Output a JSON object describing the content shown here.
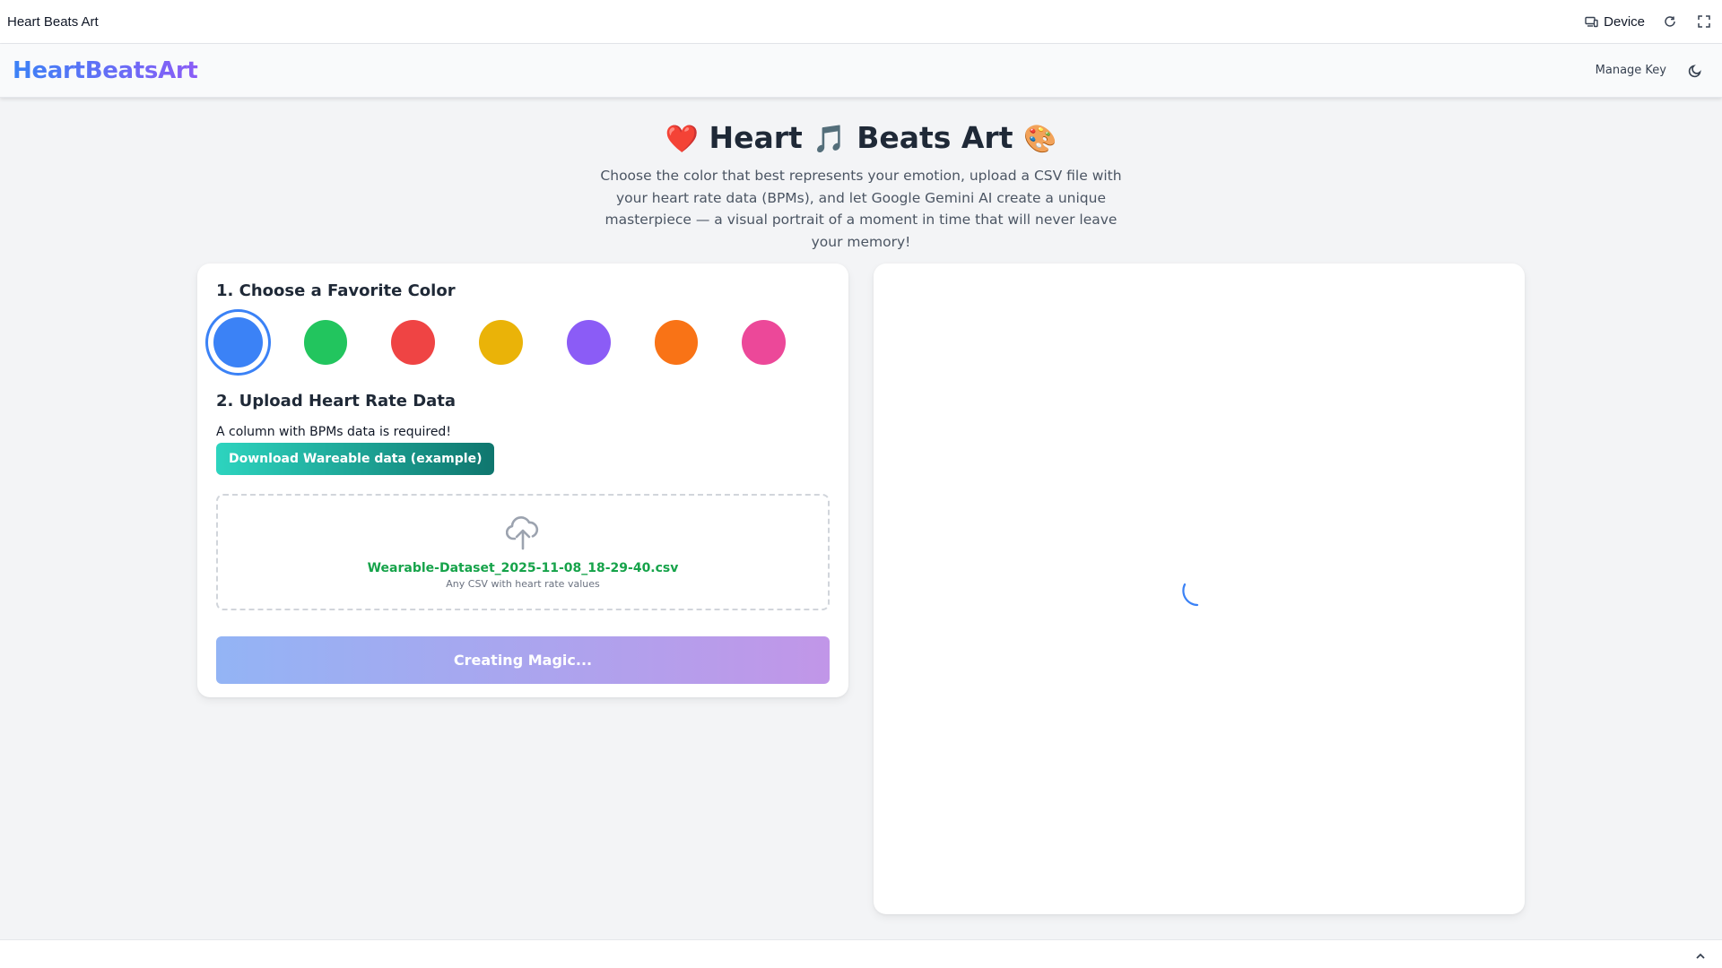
{
  "topbar": {
    "title": "Heart Beats Art",
    "device_label": "Device",
    "icons": [
      "device-icon",
      "refresh-icon",
      "fullscreen-icon"
    ]
  },
  "header": {
    "brand": "HeartBeatsArt",
    "manage_key_label": "Manage Key",
    "theme_icon": "moon-icon"
  },
  "hero": {
    "title_parts": [
      "❤️",
      "Heart",
      "🎵",
      "Beats Art",
      "🎨"
    ],
    "description": "Choose the color that best represents your emotion, upload a CSV file with your heart rate data (BPMs), and let Google Gemini AI create a unique masterpiece — a visual portrait of a moment in time that will never leave your memory!"
  },
  "form": {
    "color_section_title": "1. Choose a Favorite Color",
    "colors": [
      {
        "name": "blue",
        "hex": "#3b82f6",
        "selected": true
      },
      {
        "name": "green",
        "hex": "#22c55e",
        "selected": false
      },
      {
        "name": "red",
        "hex": "#ef4444",
        "selected": false
      },
      {
        "name": "yellow",
        "hex": "#eab308",
        "selected": false
      },
      {
        "name": "purple",
        "hex": "#8b5cf6",
        "selected": false
      },
      {
        "name": "orange",
        "hex": "#f97316",
        "selected": false
      },
      {
        "name": "pink",
        "hex": "#ec4899",
        "selected": false
      }
    ],
    "upload_section_title": "2. Upload Heart Rate Data",
    "upload_note": "A column with BPMs data is required!",
    "download_button_label": "Download Wareable data (example)",
    "upload_icon": "cloud-upload-icon",
    "file_name": "Wearable-Dataset_2025-11-08_18-29-40.csv",
    "file_hint": "Any CSV with heart rate values",
    "create_button_label": "Creating Magic..."
  },
  "preview": {
    "state_icon": "loading-spinner-icon"
  },
  "bottombar": {
    "icon": "chevron-up-icon"
  }
}
